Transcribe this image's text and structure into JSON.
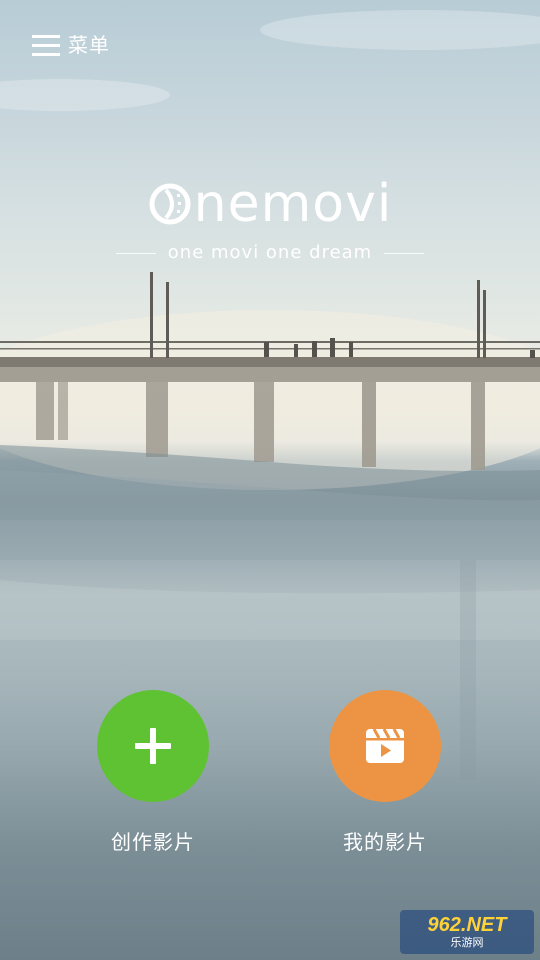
{
  "menu": {
    "icon": "hamburger-menu-icon",
    "label": "菜单"
  },
  "brand": {
    "wordmark": "nemovi",
    "logo_letter_icon": "film-reel-o-icon",
    "tagline": "one movi one dream"
  },
  "actions": {
    "create": {
      "icon": "plus-icon",
      "label": "创作影片",
      "color": "#5ec232"
    },
    "mine": {
      "icon": "clapperboard-play-icon",
      "label": "我的影片",
      "color": "#ec9443"
    }
  },
  "watermark": {
    "top": "962.NET",
    "bottom": "乐游网"
  }
}
